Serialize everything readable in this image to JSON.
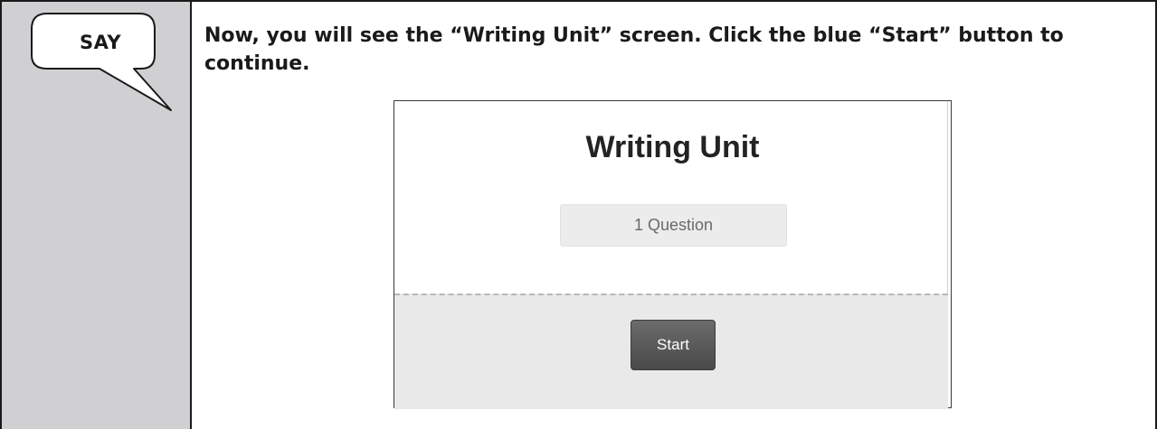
{
  "say_label": "SAY",
  "instruction": "Now, you will see the “Writing Unit” screen. Click the blue “Start” button to continue.",
  "screen": {
    "title": "Writing Unit",
    "question_count": "1 Question",
    "start_label": "Start"
  }
}
